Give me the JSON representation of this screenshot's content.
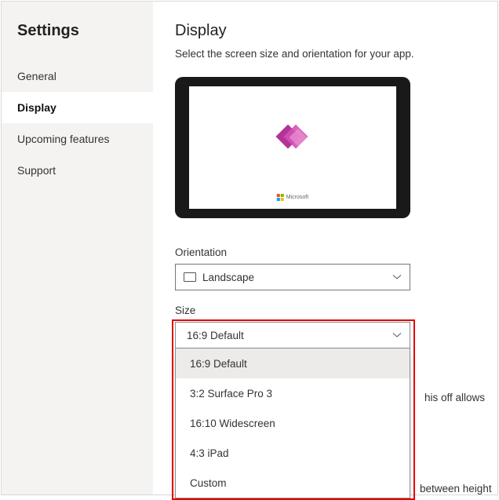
{
  "sidebar": {
    "title": "Settings",
    "items": [
      {
        "label": "General"
      },
      {
        "label": "Display"
      },
      {
        "label": "Upcoming features"
      },
      {
        "label": "Support"
      }
    ]
  },
  "main": {
    "title": "Display",
    "subtitle": "Select the screen size and orientation for your app.",
    "preview": {
      "brand": "Microsoft"
    },
    "orientation": {
      "label": "Orientation",
      "value": "Landscape"
    },
    "size": {
      "label": "Size",
      "value": "16:9 Default",
      "options": [
        "16:9 Default",
        "3:2 Surface Pro 3",
        "16:10 Widescreen",
        "4:3 iPad",
        "Custom"
      ]
    },
    "occluded": {
      "right_fragment": "his off allows",
      "bottom_fragment": "between height"
    }
  }
}
